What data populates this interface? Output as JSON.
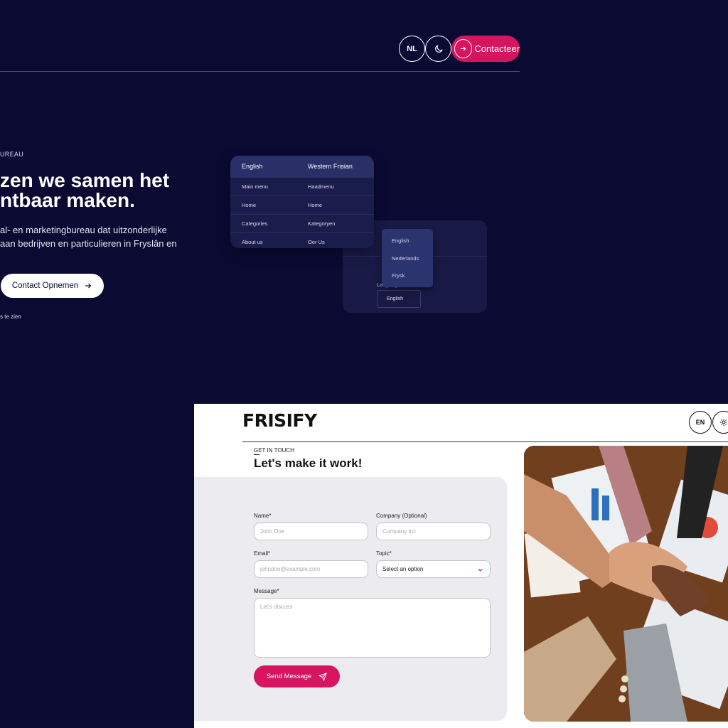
{
  "header": {
    "lang_button": "NL",
    "theme_icon": "moon-icon",
    "contact_label": "Contacteer",
    "contact_icon": "arrow-right-icon"
  },
  "hero": {
    "eyebrow": "UREAU",
    "title_line1": "zen we samen het",
    "title_line2": "ntbaar maken.",
    "text_line1": "al- en marketingbureau dat uitzonderlijke",
    "text_line2": "aan bedrijven en particulieren in Fryslân en",
    "cta_label": "Contact Opnemen",
    "note": "s te zien"
  },
  "translation_table": {
    "headers": [
      "English",
      "Western Frisian"
    ],
    "rows": [
      [
        "Main menu",
        "Haadmenu"
      ],
      [
        "Home",
        "Home"
      ],
      [
        "Categories",
        "Kategoryen"
      ],
      [
        "About us",
        "Oer Us"
      ]
    ]
  },
  "language_picker": {
    "label": "Language",
    "selected": "English",
    "options": [
      "English",
      "Nederlands",
      "Frysk"
    ]
  },
  "contact_page": {
    "logo": "FRISIFY",
    "lang_button": "EN",
    "eyebrow": "GET IN TOUCH",
    "title": "Let's make it work!",
    "form": {
      "name_label": "Name*",
      "name_placeholder": "John Doe",
      "company_label": "Company (Optional)",
      "company_placeholder": "Company Inc",
      "email_label": "Email*",
      "email_placeholder": "johndoe@example.com",
      "topic_label": "Topic*",
      "topic_value": "Select an option",
      "message_label": "Message*",
      "message_placeholder": "Let's discuss",
      "submit_label": "Send Message"
    }
  },
  "colors": {
    "background": "#0a0a33",
    "accent": "#d6145f",
    "form_background": "#ececee"
  }
}
